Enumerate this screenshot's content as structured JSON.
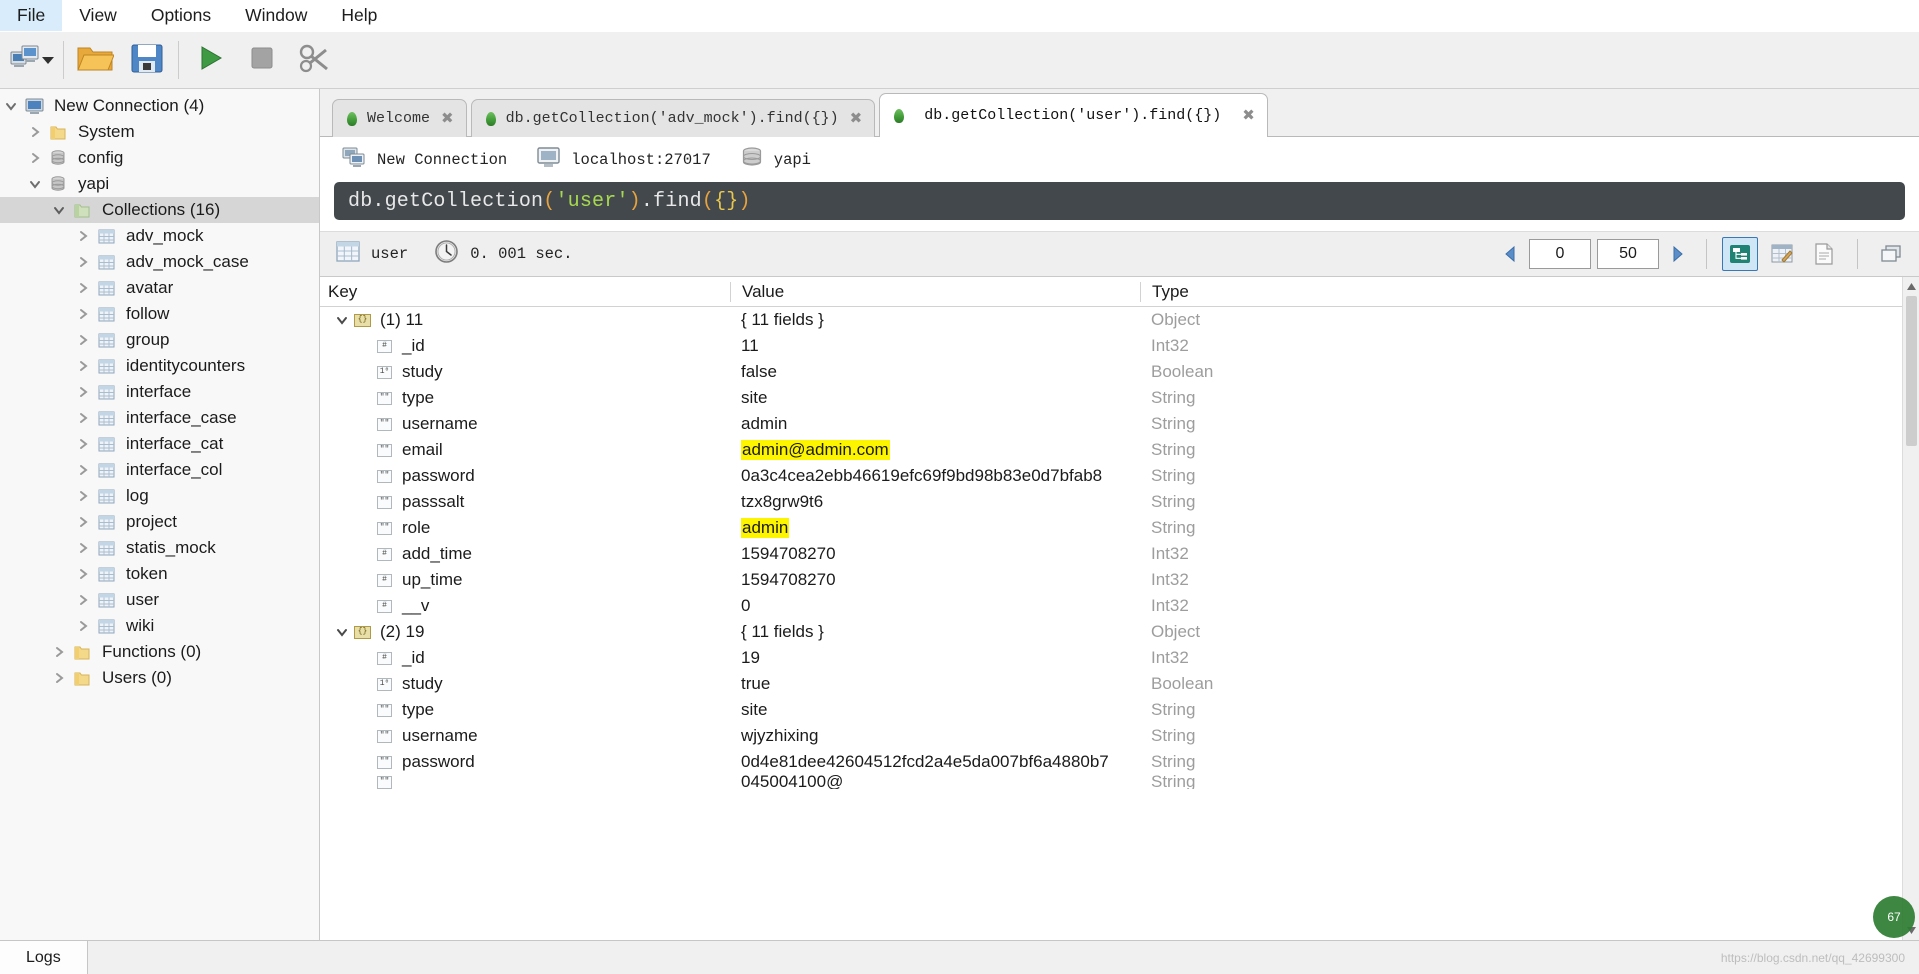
{
  "menubar": {
    "items": [
      {
        "label": "File",
        "active": true
      },
      {
        "label": "View",
        "active": false
      },
      {
        "label": "Options",
        "active": false
      },
      {
        "label": "Window",
        "active": false
      },
      {
        "label": "Help",
        "active": false
      }
    ]
  },
  "toolbar": {
    "buttons": [
      {
        "name": "connect-icon",
        "tooltip": "Connect"
      },
      {
        "name": "connect-dropdown-icon",
        "tooltip": "Connect dropdown"
      },
      {
        "name": "open-folder-icon",
        "tooltip": "Open Script"
      },
      {
        "name": "save-icon",
        "tooltip": "Save Script"
      },
      {
        "name": "execute-play-icon",
        "tooltip": "Execute"
      },
      {
        "name": "stop-icon",
        "tooltip": "Stop"
      },
      {
        "name": "preferences-icon",
        "tooltip": "Preferences"
      }
    ]
  },
  "tree": {
    "nodes": [
      {
        "label": "New Connection (4)",
        "icon": "server-icon",
        "depth": 0,
        "state": "expanded",
        "selected": false
      },
      {
        "label": "System",
        "icon": "folder-icon",
        "depth": 1,
        "state": "collapsed",
        "selected": false
      },
      {
        "label": "config",
        "icon": "database-icon",
        "depth": 1,
        "state": "collapsed",
        "selected": false
      },
      {
        "label": "yapi",
        "icon": "database-icon",
        "depth": 1,
        "state": "expanded",
        "selected": false
      },
      {
        "label": "Collections (16)",
        "icon": "folder-green-icon",
        "depth": 2,
        "state": "expanded",
        "selected": true
      },
      {
        "label": "adv_mock",
        "icon": "collection-icon",
        "depth": 3,
        "state": "collapsed",
        "selected": false
      },
      {
        "label": "adv_mock_case",
        "icon": "collection-icon",
        "depth": 3,
        "state": "collapsed",
        "selected": false
      },
      {
        "label": "avatar",
        "icon": "collection-icon",
        "depth": 3,
        "state": "collapsed",
        "selected": false
      },
      {
        "label": "follow",
        "icon": "collection-icon",
        "depth": 3,
        "state": "collapsed",
        "selected": false
      },
      {
        "label": "group",
        "icon": "collection-icon",
        "depth": 3,
        "state": "collapsed",
        "selected": false
      },
      {
        "label": "identitycounters",
        "icon": "collection-icon",
        "depth": 3,
        "state": "collapsed",
        "selected": false
      },
      {
        "label": "interface",
        "icon": "collection-icon",
        "depth": 3,
        "state": "collapsed",
        "selected": false
      },
      {
        "label": "interface_case",
        "icon": "collection-icon",
        "depth": 3,
        "state": "collapsed",
        "selected": false
      },
      {
        "label": "interface_cat",
        "icon": "collection-icon",
        "depth": 3,
        "state": "collapsed",
        "selected": false
      },
      {
        "label": "interface_col",
        "icon": "collection-icon",
        "depth": 3,
        "state": "collapsed",
        "selected": false
      },
      {
        "label": "log",
        "icon": "collection-icon",
        "depth": 3,
        "state": "collapsed",
        "selected": false
      },
      {
        "label": "project",
        "icon": "collection-icon",
        "depth": 3,
        "state": "collapsed",
        "selected": false
      },
      {
        "label": "statis_mock",
        "icon": "collection-icon",
        "depth": 3,
        "state": "collapsed",
        "selected": false
      },
      {
        "label": "token",
        "icon": "collection-icon",
        "depth": 3,
        "state": "collapsed",
        "selected": false
      },
      {
        "label": "user",
        "icon": "collection-icon",
        "depth": 3,
        "state": "collapsed",
        "selected": false
      },
      {
        "label": "wiki",
        "icon": "collection-icon",
        "depth": 3,
        "state": "collapsed",
        "selected": false
      },
      {
        "label": "Functions (0)",
        "icon": "folder-icon",
        "depth": 2,
        "state": "collapsed",
        "selected": false
      },
      {
        "label": "Users (0)",
        "icon": "folder-icon",
        "depth": 2,
        "state": "collapsed",
        "selected": false
      }
    ]
  },
  "tabs": [
    {
      "label": "Welcome",
      "active": false,
      "closable": true
    },
    {
      "label": "db.getCollection('adv_mock').find({})",
      "active": false,
      "closable": true
    },
    {
      "label": "db.getCollection('user').find({})",
      "active": true,
      "closable": true
    }
  ],
  "breadcrumb": [
    {
      "label": "New Connection",
      "icon": "connection-icon"
    },
    {
      "label": "localhost:27017",
      "icon": "server-monitor-icon"
    },
    {
      "label": "yapi",
      "icon": "database-icon"
    }
  ],
  "editor": {
    "parts": [
      {
        "text": "db.getCollection",
        "color": "white"
      },
      {
        "text": "(",
        "color": "orange"
      },
      {
        "text": "'user'",
        "color": "green"
      },
      {
        "text": ")",
        "color": "orange"
      },
      {
        "text": ".find",
        "color": "white"
      },
      {
        "text": "(",
        "color": "orange"
      },
      {
        "text": "{}",
        "color": "yellow"
      },
      {
        "text": ")",
        "color": "orange"
      }
    ],
    "plain": "db.getCollection('user').find({})"
  },
  "results_toolbar": {
    "collection": "user",
    "elapsed": "0. 001 sec.",
    "page_skip": "0",
    "page_limit": "50",
    "view_modes": [
      {
        "name": "tree-view-button",
        "active": true
      },
      {
        "name": "table-view-button",
        "active": false
      },
      {
        "name": "text-view-button",
        "active": false
      }
    ],
    "extra_button": {
      "name": "expand-window-button"
    }
  },
  "grid": {
    "columns": [
      "Key",
      "Value",
      "Type"
    ],
    "rows": [
      {
        "indent": 0,
        "twisty": "expanded",
        "icon": "object-icon",
        "key": "(1) 11",
        "value": "{ 11 fields }",
        "type": "Object",
        "highlight": false
      },
      {
        "indent": 1,
        "twisty": "none",
        "icon": "int-icon",
        "key": "_id",
        "value": "11",
        "type": "Int32",
        "highlight": false
      },
      {
        "indent": 1,
        "twisty": "none",
        "icon": "bool-icon",
        "key": "study",
        "value": "false",
        "type": "Boolean",
        "highlight": false
      },
      {
        "indent": 1,
        "twisty": "none",
        "icon": "string-icon",
        "key": "type",
        "value": "site",
        "type": "String",
        "highlight": false
      },
      {
        "indent": 1,
        "twisty": "none",
        "icon": "string-icon",
        "key": "username",
        "value": "admin",
        "type": "String",
        "highlight": false
      },
      {
        "indent": 1,
        "twisty": "none",
        "icon": "string-icon",
        "key": "email",
        "value": "admin@admin.com",
        "type": "String",
        "highlight": true
      },
      {
        "indent": 1,
        "twisty": "none",
        "icon": "string-icon",
        "key": "password",
        "value": "0a3c4cea2ebb46619efc69f9bd98b83e0d7bfab8",
        "type": "String",
        "highlight": false
      },
      {
        "indent": 1,
        "twisty": "none",
        "icon": "string-icon",
        "key": "passsalt",
        "value": "tzx8grw9t6",
        "type": "String",
        "highlight": false
      },
      {
        "indent": 1,
        "twisty": "none",
        "icon": "string-icon",
        "key": "role",
        "value": "admin",
        "type": "String",
        "highlight": true
      },
      {
        "indent": 1,
        "twisty": "none",
        "icon": "int-icon",
        "key": "add_time",
        "value": "1594708270",
        "type": "Int32",
        "highlight": false
      },
      {
        "indent": 1,
        "twisty": "none",
        "icon": "int-icon",
        "key": "up_time",
        "value": "1594708270",
        "type": "Int32",
        "highlight": false
      },
      {
        "indent": 1,
        "twisty": "none",
        "icon": "int-icon",
        "key": "__v",
        "value": "0",
        "type": "Int32",
        "highlight": false
      },
      {
        "indent": 0,
        "twisty": "expanded",
        "icon": "object-icon",
        "key": "(2) 19",
        "value": "{ 11 fields }",
        "type": "Object",
        "highlight": false
      },
      {
        "indent": 1,
        "twisty": "none",
        "icon": "int-icon",
        "key": "_id",
        "value": "19",
        "type": "Int32",
        "highlight": false
      },
      {
        "indent": 1,
        "twisty": "none",
        "icon": "bool-icon",
        "key": "study",
        "value": "true",
        "type": "Boolean",
        "highlight": false
      },
      {
        "indent": 1,
        "twisty": "none",
        "icon": "string-icon",
        "key": "type",
        "value": "site",
        "type": "String",
        "highlight": false
      },
      {
        "indent": 1,
        "twisty": "none",
        "icon": "string-icon",
        "key": "username",
        "value": "wjyzhixing",
        "type": "String",
        "highlight": false
      },
      {
        "indent": 1,
        "twisty": "none",
        "icon": "string-icon",
        "key": "password",
        "value": "0d4e81dee42604512fcd2a4e5da007bf6a4880b7",
        "type": "String",
        "highlight": false
      },
      {
        "indent": 1,
        "twisty": "none",
        "icon": "string-icon",
        "key": "",
        "value": "045004100@",
        "type": "String",
        "highlight": false
      }
    ]
  },
  "statusbar": {
    "logs_label": "Logs",
    "watermark": "https://blog.csdn.net/qq_42699300"
  },
  "colors": {
    "accent": "#3a77b5",
    "highlight": "#fdf500",
    "editor_bg": "#43484d",
    "selection": "#d6d6d6",
    "menu_active": "#d9ecfb"
  },
  "badge": {
    "text": "67"
  }
}
